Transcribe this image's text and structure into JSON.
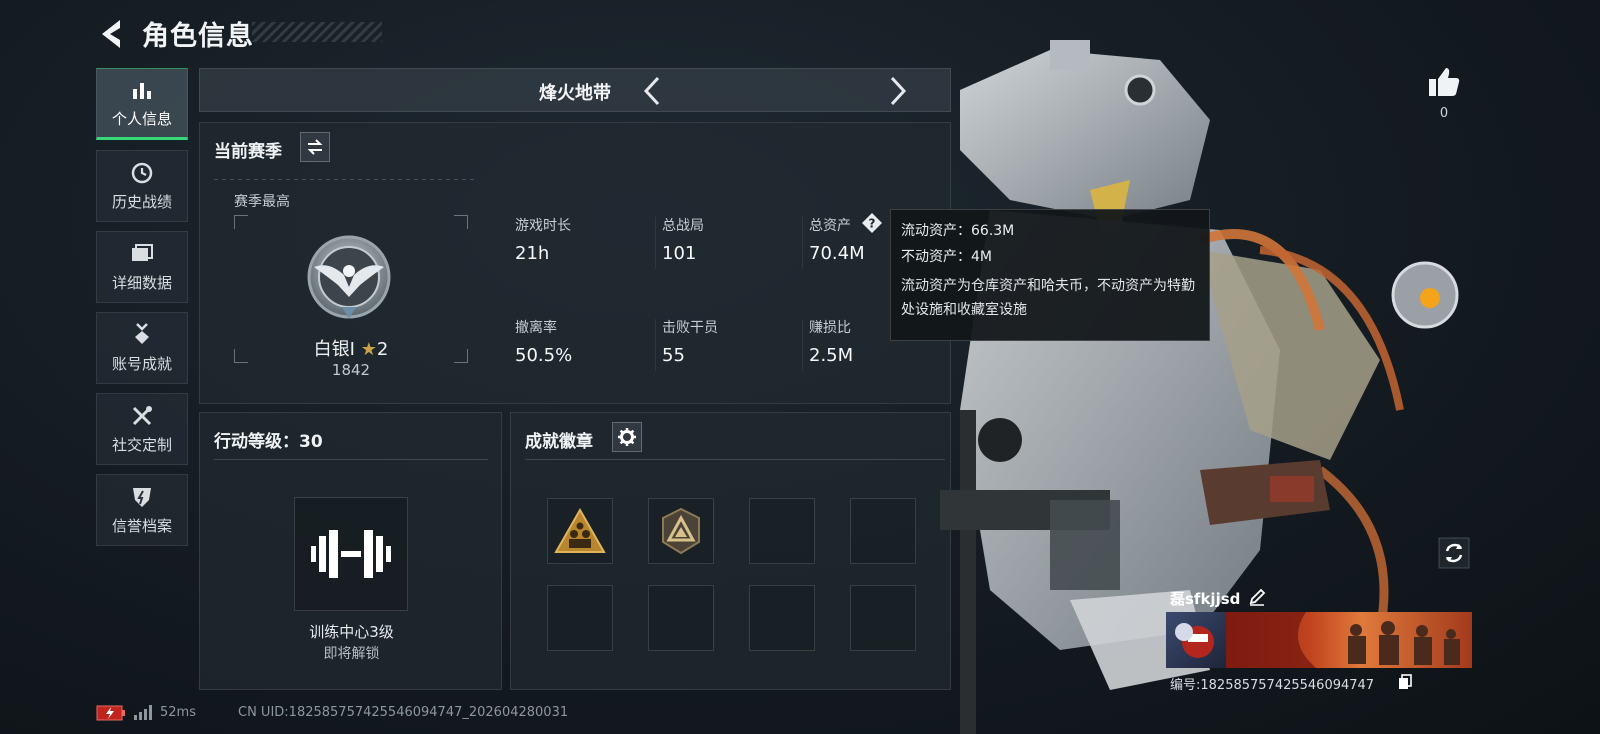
{
  "header": {
    "title": "角色信息"
  },
  "sidebar": {
    "items": [
      {
        "label": "个人信息",
        "icon": "bar-chart-icon",
        "active": true
      },
      {
        "label": "历史战绩",
        "icon": "history-icon",
        "active": false
      },
      {
        "label": "详细数据",
        "icon": "folder-icon",
        "active": false
      },
      {
        "label": "账号成就",
        "icon": "medal-icon",
        "active": false
      },
      {
        "label": "社交定制",
        "icon": "tools-icon",
        "active": false
      },
      {
        "label": "信誉档案",
        "icon": "shield-icon",
        "active": false
      }
    ]
  },
  "mode": {
    "name": "烽火地带"
  },
  "season": {
    "title": "当前赛季",
    "best_label": "赛季最高",
    "rank_name": "白银I",
    "rank_stars": "2",
    "rank_score": "1842",
    "stats": [
      {
        "label": "游戏时长",
        "value": "21h"
      },
      {
        "label": "总战局",
        "value": "101"
      },
      {
        "label": "总资产",
        "value": "70.4M"
      },
      {
        "label": "撤离率",
        "value": "50.5%"
      },
      {
        "label": "击败干员",
        "value": "55"
      },
      {
        "label": "赚损比",
        "value": "2.5M"
      }
    ]
  },
  "tooltip": {
    "liquid": "流动资产：66.3M",
    "fixed": "不动资产：4M",
    "desc": "流动资产为仓库资产和哈夫币，不动资产为特勤处设施和收藏室设施"
  },
  "action_level": {
    "title": "行动等级：30",
    "item_name": "训练中心3级",
    "item_status": "即将解锁"
  },
  "achievements": {
    "title": "成就徽章",
    "filled_slots": 2,
    "total_slots": 8
  },
  "likes": {
    "count": "0"
  },
  "player": {
    "name": "磊sfkjjsd",
    "id_line": "编号:1825857574255460947​47"
  },
  "footer": {
    "ping": "52ms",
    "uid": "CN UID:182585757425546094747_202604280031"
  },
  "colors": {
    "accent": "#35d97a",
    "gold": "#c9a24a",
    "panel": "#212a31"
  }
}
